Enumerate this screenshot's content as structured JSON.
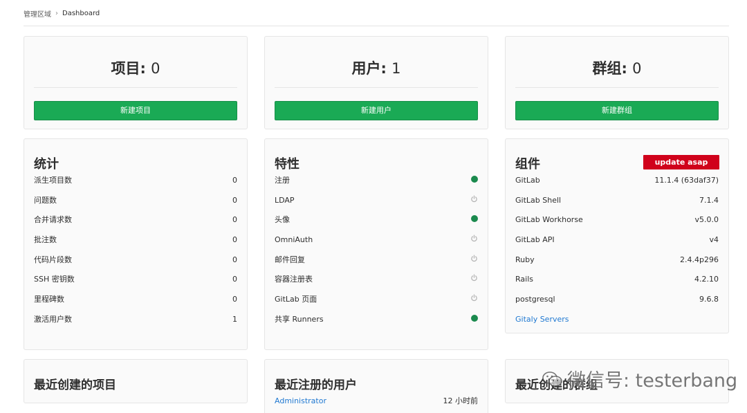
{
  "breadcrumb": {
    "root": "管理区域",
    "current": "Dashboard"
  },
  "stats": [
    {
      "label": "项目",
      "value": "0",
      "button": "新建项目"
    },
    {
      "label": "用户",
      "value": "1",
      "button": "新建用户"
    },
    {
      "label": "群组",
      "value": "0",
      "button": "新建群组"
    }
  ],
  "statistics": {
    "title": "统计",
    "rows": [
      {
        "label": "派生项目数",
        "value": "0"
      },
      {
        "label": "问题数",
        "value": "0"
      },
      {
        "label": "合并请求数",
        "value": "0"
      },
      {
        "label": "批注数",
        "value": "0"
      },
      {
        "label": "代码片段数",
        "value": "0"
      },
      {
        "label": "SSH 密钥数",
        "value": "0"
      },
      {
        "label": "里程碑数",
        "value": "0"
      },
      {
        "label": "激活用户数",
        "value": "1"
      }
    ]
  },
  "features": {
    "title": "特性",
    "rows": [
      {
        "label": "注册",
        "status": "enabled"
      },
      {
        "label": "LDAP",
        "status": "disabled"
      },
      {
        "label": "头像",
        "status": "enabled"
      },
      {
        "label": "OmniAuth",
        "status": "disabled"
      },
      {
        "label": "邮件回复",
        "status": "disabled"
      },
      {
        "label": "容器注册表",
        "status": "disabled"
      },
      {
        "label": "GitLab 页面",
        "status": "disabled"
      },
      {
        "label": "共享 Runners",
        "status": "enabled"
      }
    ]
  },
  "components": {
    "title": "组件",
    "badge": "update asap",
    "rows": [
      {
        "label": "GitLab",
        "value": "11.1.4 (63daf37)"
      },
      {
        "label": "GitLab Shell",
        "value": "7.1.4"
      },
      {
        "label": "GitLab Workhorse",
        "value": "v5.0.0"
      },
      {
        "label": "GitLab API",
        "value": "v4"
      },
      {
        "label": "Ruby",
        "value": "2.4.4p296"
      },
      {
        "label": "Rails",
        "value": "4.2.10"
      },
      {
        "label": "postgresql",
        "value": "9.6.8"
      }
    ],
    "link": "Gitaly Servers"
  },
  "recent": {
    "projects_title": "最近创建的项目",
    "users_title": "最近注册的用户",
    "users": [
      {
        "name": "Administrator",
        "time": "12 小时前"
      }
    ],
    "groups_title": "最近创建的群组"
  },
  "watermark": "微信号: testerbang",
  "colors": {
    "green": "#1aaa55",
    "status_on": "#1b8a4e",
    "status_off": "#b5b5b5",
    "badge": "#d0021b",
    "link": "#1f78d1"
  }
}
